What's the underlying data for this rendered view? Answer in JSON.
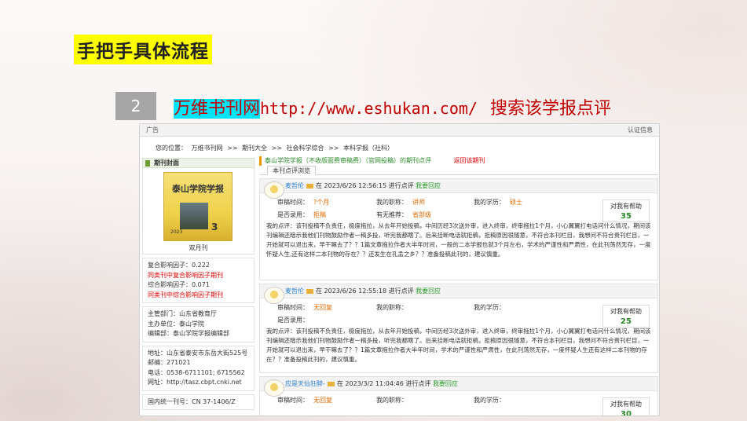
{
  "slide": {
    "title": "手把手具体流程",
    "step_number": "2",
    "site_name": "万维书刊网",
    "site_url": "http://www.eshukan.com/",
    "step_action": "搜索该学报点评"
  },
  "screenshot": {
    "ad_label": "广告",
    "auth_info": "认证信息",
    "breadcrumb": [
      "您的位置：",
      "万维书刊网",
      ">>",
      "期刊大全",
      ">>",
      "社会科学综合",
      ">>",
      "本科学报（社科）"
    ],
    "sidebar": {
      "cover_heading": "期刊封面",
      "cover_title": "泰山学院学报",
      "cover_year": "2023",
      "cover_issue": "3",
      "frequency": "双月刊",
      "metrics": [
        {
          "text": "复合影响因子：0.222",
          "red": false
        },
        {
          "text": "同类刊中复合影响因子期刊",
          "red": true
        },
        {
          "text": "综合影响因子：0.071",
          "red": false
        },
        {
          "text": "同类刊中综合影响因子期刊",
          "red": true
        }
      ],
      "org": [
        "主管部门：山东省教育厅",
        "主办单位：泰山学院",
        "编辑部：泰山学院学报编辑部"
      ],
      "contact": [
        "地址：山东省泰安市东岳大街525号",
        "邮编：271021",
        "电话：0538-6711101; 6715562",
        "网址：http://tasz.cbpt.cnki.net"
      ],
      "issn": "国内统一刊号：CN 37-1406/Z"
    },
    "journal_title": "泰山学院学报（不收版面费审稿费）（官网投稿）的期刊点评",
    "back_link": "返回该期刊",
    "tab_label": "本刊点评浏览",
    "reviews": [
      {
        "name": "麦哲伦",
        "time": "在 2023/6/26 12:56:15 进行点评",
        "reply": "我要回应",
        "review_time_label": "审稿时间：",
        "review_time": "?个月",
        "title_label": "我的职称：",
        "title": "讲师",
        "degree_label": "我的学历：",
        "degree": "硕士",
        "accepted_label": "是否录用：",
        "accepted": "拒稿",
        "recommend_label": "有无推荐：",
        "recommend": "省部级",
        "help_label": "对我有帮助",
        "help_count": "35",
        "body": "我的点评：该刊投稿不负责任，极度拖拉，从去年开始投稿，中间历经3次送外审，进入终审，终审拖拉1个月，小心翼翼打电话问什么情况，期间该刊编辑还暗示我他们刊物鼓励作者一稿多投，听完我都瞎了。后来挂断电话就拒稿，拒稿原因很随意，不符合本刊栏目，我想问不符合贵刊栏目，一开始就可以退出来，早干嘛去了？？1篇文章拖拉作者大半年时间，一般的二本学报也就3个月左右，学术的严谨性和严肃性，在此刊荡然无存，一度怀疑人生,还有这样二本刊物的存在？？还发生在孔孟之乡？？准备投稿此刊的，建议慎重。"
      },
      {
        "name": "麦哲伦",
        "time": "在 2023/6/26 12:55:18 进行点评",
        "reply": "我要回应",
        "review_time_label": "审稿时间：",
        "review_time": "无回复",
        "title_label": "我的职称：",
        "title": "",
        "degree_label": "我的学历：",
        "degree": "",
        "accepted_label": "是否录用：",
        "accepted": "",
        "recommend_label": "",
        "recommend": "",
        "help_label": "对我有帮助",
        "help_count": "25",
        "body": "我的点评：该刊投稿不负责任，极度拖拉，从去年开始投稿，中间历经3次送外审，进入终审，终审拖拉1个月，小心翼翼打电话问什么情况，期间该刊编辑还暗示我他们刊物鼓励作者一稿多投，听完我都瞎了。后来挂断电话就拒稿，拒稿原因很随意，不符合本刊栏目，我想问不符合贵刊栏目，一开始就可以退出来，早干嘛去了？？1篇文章拖拉作者大半年时间，学术的严谨性和严肃性，在此刊荡然无存，一度怀疑人生还有这样二本刊物的存在？？准备投稿此刊的，建议慎重。"
      },
      {
        "name": "应是天仙狂醉-",
        "time": "在 2023/3/2 11:04:46 进行点评",
        "reply": "我要回应",
        "review_time_label": "审稿时间：",
        "review_time": "无回复",
        "title_label": "我的职称：",
        "title": "",
        "degree_label": "我的学历：",
        "degree": "",
        "accepted_label": "",
        "accepted": "",
        "recommend_label": "",
        "recommend": "",
        "help_label": "对我有帮助",
        "help_count": "30",
        "body": ""
      }
    ]
  }
}
